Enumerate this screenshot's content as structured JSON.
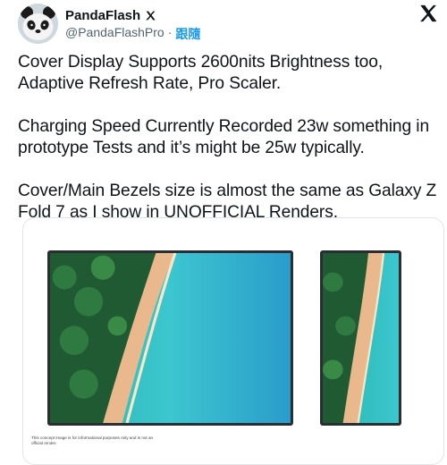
{
  "author": {
    "display_name": "PandaFlash",
    "handle": "@PandaFlashPro",
    "separator": "·",
    "follow_label": "跟隨",
    "badge_icon": "x-badge-icon",
    "avatar_icon": "panda-avatar"
  },
  "tweet": {
    "paragraphs": [
      "Cover Display Supports 2600nits Brightness too, Adaptive Refresh Rate, Pro Scaler.",
      "Charging Speed Currently Recorded 23w something in prototype Tests and it’s might be 25w typically.",
      "Cover/Main Bezels size is almost the same as Galaxy Z Fold 7 as I show in UNOFFICIAL Renders."
    ]
  },
  "media": {
    "disclaimer": "This concept image is for informational purposes only and is not an official render.",
    "frame_color": "#2a2d31"
  },
  "colors": {
    "text": "#0f1419",
    "secondary": "#536471",
    "accent": "#1d9bf0"
  }
}
